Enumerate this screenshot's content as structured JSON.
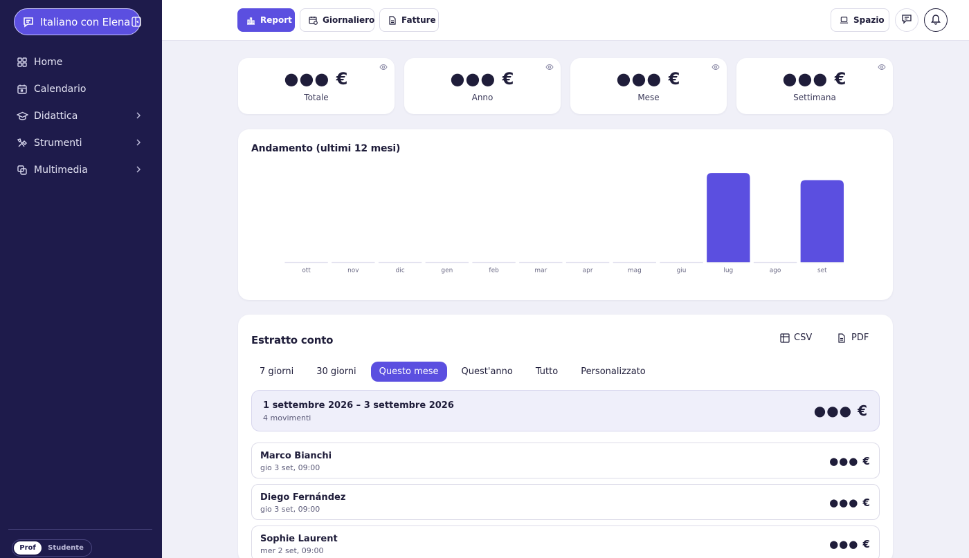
{
  "sidebar": {
    "brand": "Italiano con Elena",
    "items": [
      {
        "label": "Home",
        "icon": "grid-icon",
        "has_submenu": false
      },
      {
        "label": "Calendario",
        "icon": "calendar-icon",
        "has_submenu": false
      },
      {
        "label": "Didattica",
        "icon": "graduation-cap-icon",
        "has_submenu": true
      },
      {
        "label": "Strumenti",
        "icon": "tools-icon",
        "has_submenu": true
      },
      {
        "label": "Multimedia",
        "icon": "media-icon",
        "has_submenu": true
      }
    ],
    "role_toggle": {
      "active": "Prof",
      "other": "Studente"
    }
  },
  "topbar": {
    "tabs": [
      {
        "label": "Report",
        "icon": "bar-chart-icon",
        "active": true
      },
      {
        "label": "Giornaliero",
        "icon": "calendar-clock-icon",
        "active": false
      },
      {
        "label": "Fatture",
        "icon": "document-icon",
        "active": false
      }
    ],
    "space_label": "Spazio"
  },
  "stats": [
    {
      "value": "●●● €",
      "label": "Totale"
    },
    {
      "value": "●●● €",
      "label": "Anno"
    },
    {
      "value": "●●● €",
      "label": "Mese"
    },
    {
      "value": "●●● €",
      "label": "Settimana"
    }
  ],
  "chart_title": "Andamento (ultimi 12 mesi)",
  "chart_data": {
    "type": "bar",
    "title": "Andamento (ultimi 12 mesi)",
    "categories": [
      "ott",
      "nov",
      "dic",
      "gen",
      "feb",
      "mar",
      "apr",
      "mag",
      "giu",
      "lug",
      "ago",
      "set"
    ],
    "values": [
      0,
      0,
      0,
      0,
      0,
      0,
      0,
      0,
      0,
      100,
      0,
      92
    ],
    "value_note": "values relative; amounts hidden",
    "ylim": [
      0,
      100
    ],
    "grid": false,
    "color": "#5b4fe0"
  },
  "statement": {
    "title": "Estratto conto",
    "export_csv": "CSV",
    "export_pdf": "PDF",
    "filters": [
      "7 giorni",
      "30 giorni",
      "Questo mese",
      "Quest'anno",
      "Tutto",
      "Personalizzato"
    ],
    "active_filter": "Questo mese",
    "summary": {
      "range": "1 settembre 2026 – 3 settembre 2026",
      "count": "4 movimenti",
      "amount": "●●● €"
    },
    "rows": [
      {
        "name": "Marco Bianchi",
        "meta": "gio 3 set, 09:00",
        "amount": "●●● €"
      },
      {
        "name": "Diego Fernández",
        "meta": "gio 3 set, 09:00",
        "amount": "●●● €"
      },
      {
        "name": "Sophie Laurent",
        "meta": "mer 2 set, 09:00",
        "amount": "●●● €"
      }
    ]
  },
  "colors": {
    "accent": "#5b4fe0",
    "sidebar_bg": "#1e1b4b",
    "page_bg": "#f0f0f8"
  }
}
